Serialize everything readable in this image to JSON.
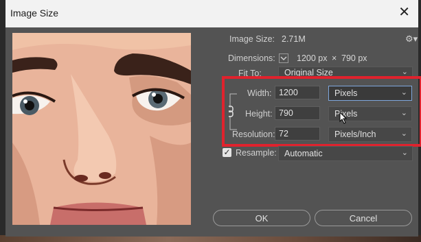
{
  "dialog": {
    "title": "Image Size",
    "close_glyph": "✕"
  },
  "info": {
    "image_size_label": "Image Size:",
    "image_size_value": "2.71M",
    "dimensions_label": "Dimensions:",
    "dimensions_width": "1200 px",
    "dimensions_sep": "×",
    "dimensions_height": "790 px",
    "fit_to_label": "Fit To:",
    "fit_to_value": "Original Size"
  },
  "fields": {
    "width_label": "Width:",
    "width_value": "1200",
    "width_unit": "Pixels",
    "height_label": "Height:",
    "height_value": "790",
    "height_unit": "Pixels",
    "resolution_label": "Resolution:",
    "resolution_value": "72",
    "resolution_unit": "Pixels/Inch"
  },
  "resample": {
    "label": "Resample:",
    "checked": true,
    "value": "Automatic"
  },
  "buttons": {
    "ok": "OK",
    "cancel": "Cancel"
  },
  "icons": {
    "gear": "gear-icon",
    "chain": "link-chain-icon",
    "chevron": "chevron-down-icon",
    "check": "checkmark-icon"
  },
  "colors": {
    "highlight_box": "#e0222d",
    "dialog_bg": "#535353",
    "titlebar_bg": "#f2f2f2"
  }
}
